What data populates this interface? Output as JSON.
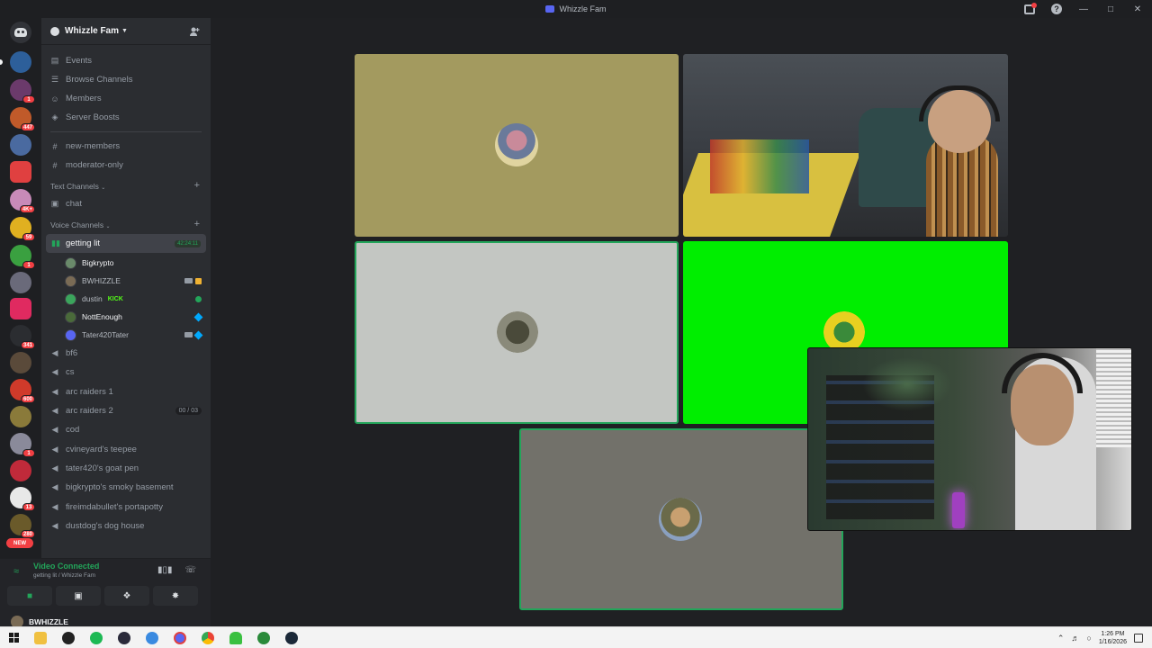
{
  "window": {
    "title": "Whizzle Fam"
  },
  "server": {
    "name": "Whizzle Fam"
  },
  "nav": [
    {
      "label": "Events",
      "icon": "calendar-icon"
    },
    {
      "label": "Browse Channels",
      "icon": "browse-icon"
    },
    {
      "label": "Members",
      "icon": "members-icon"
    },
    {
      "label": "Server Boosts",
      "icon": "boost-icon"
    }
  ],
  "pinned_channels": [
    {
      "label": "new-members"
    },
    {
      "label": "moderator-only"
    }
  ],
  "categories": {
    "text": "Text Channels",
    "voice": "Voice Channels"
  },
  "text_channels": [
    {
      "label": "chat"
    }
  ],
  "active_voice": {
    "label": "getting lit",
    "timer": "42:24:11"
  },
  "voice_members": [
    {
      "name": "Bigkrypto",
      "bright": true,
      "avatar_color": "#6a8a6a"
    },
    {
      "name": "BWHIZZLE",
      "bright": false,
      "avatar_color": "#7a6b55"
    },
    {
      "name": "dustin",
      "bright": false,
      "avatar_color": "#3ba55c",
      "tag": "KICK"
    },
    {
      "name": "NottEnough",
      "bright": true,
      "avatar_color": "#4a6a3a"
    },
    {
      "name": "Tater420Tater",
      "bright": false,
      "avatar_color": "#5865f2"
    }
  ],
  "voice_channels": [
    {
      "label": "bf6"
    },
    {
      "label": "cs"
    },
    {
      "label": "arc raiders 1"
    },
    {
      "label": "arc raiders 2",
      "count": "00 / 03"
    },
    {
      "label": "cod"
    },
    {
      "label": "cvineyard's teepee"
    },
    {
      "label": "tater420's goat pen"
    },
    {
      "label": "bigkrypto's smoky basement"
    },
    {
      "label": "fireimdabullet's portapotty"
    },
    {
      "label": "dustdog's dog house"
    }
  ],
  "voice_panel": {
    "status": "Video Connected",
    "sub": "getting lit / Whizzle Fam",
    "username": "BWHIZZLE"
  },
  "rail_badges": [
    "1",
    "447",
    "4K+",
    "59",
    "1",
    "341",
    "600",
    "1",
    "13",
    "280",
    "NEW"
  ],
  "taskbar": {
    "time": "1:26 PM",
    "date": "1/16/2026"
  },
  "colors": {
    "accent": "#5865f2",
    "online": "#23a55a",
    "danger": "#f23f43"
  }
}
